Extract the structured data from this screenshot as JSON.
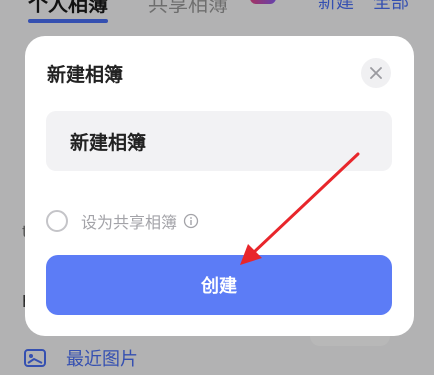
{
  "background": {
    "tabs": [
      {
        "label": "个人相簿"
      },
      {
        "label": "共享相簿"
      }
    ],
    "actions": {
      "new": "新建",
      "all": "全部"
    },
    "recent": {
      "label": "最近图片",
      "icon": "image-icon"
    }
  },
  "dialog": {
    "title": "新建相簿",
    "close_icon": "close-icon",
    "name_input": {
      "value": "新建相簿"
    },
    "share_option": {
      "label": "设为共享相簿",
      "checked": false,
      "info_icon": "info-icon"
    },
    "create_button": "创建"
  },
  "annotation": {
    "arrow_color": "#e8262b"
  },
  "colors": {
    "accent": "#5c7cf6",
    "brand": "#4a6ff5"
  }
}
